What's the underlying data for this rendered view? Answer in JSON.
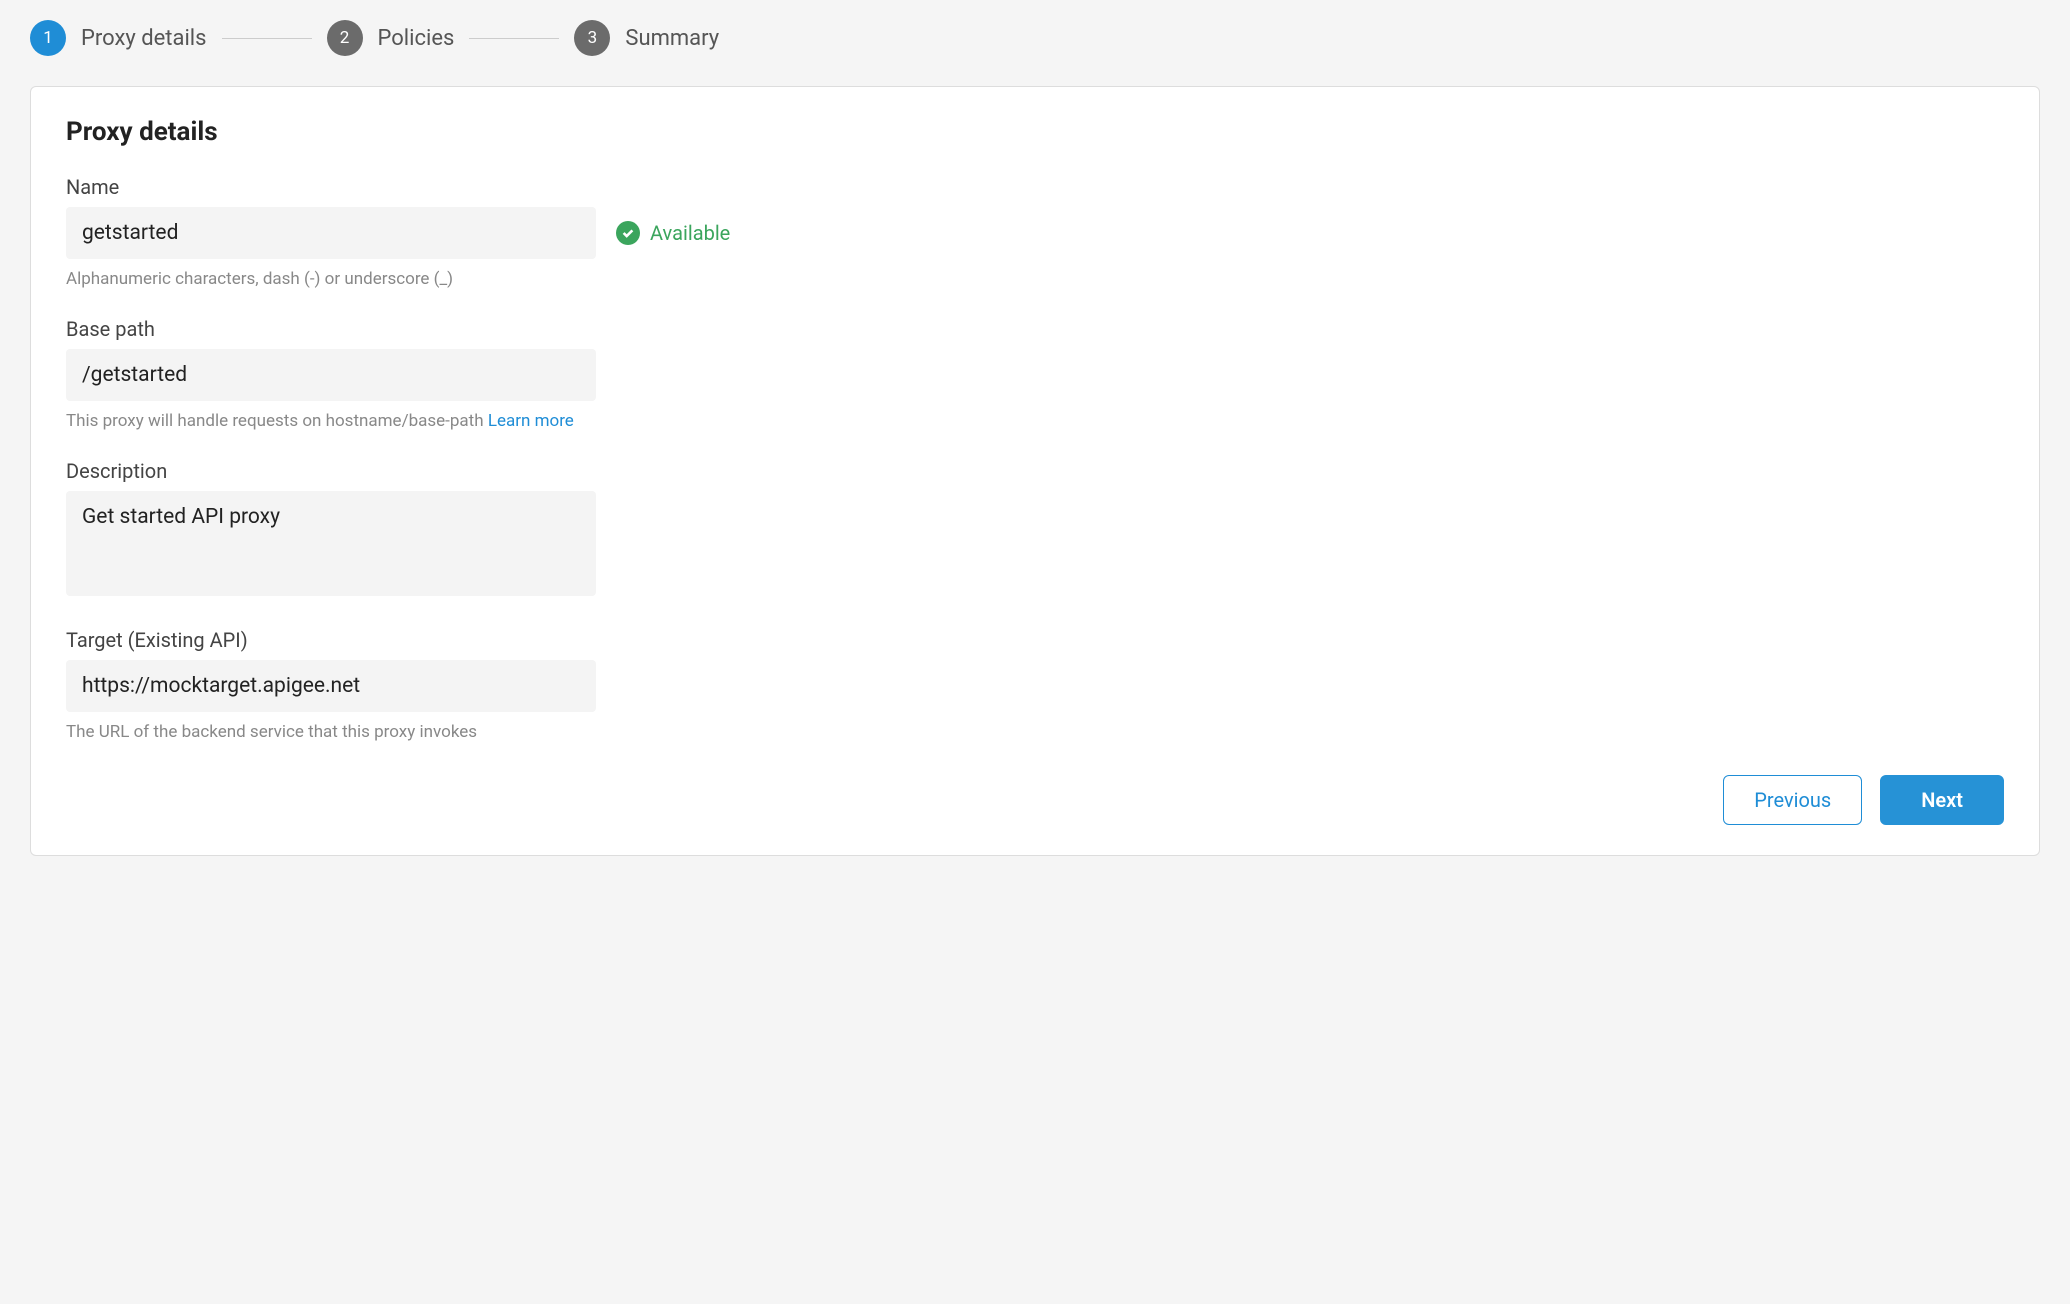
{
  "stepper": {
    "steps": [
      {
        "num": "1",
        "label": "Proxy details"
      },
      {
        "num": "2",
        "label": "Policies"
      },
      {
        "num": "3",
        "label": "Summary"
      }
    ]
  },
  "panel": {
    "title": "Proxy details"
  },
  "form": {
    "name": {
      "label": "Name",
      "value": "getstarted",
      "helper": "Alphanumeric characters, dash (-) or underscore (_)",
      "availability": "Available"
    },
    "basepath": {
      "label": "Base path",
      "value": "/getstarted",
      "helper": "This proxy will handle requests on hostname/base-path ",
      "learn_more": "Learn more"
    },
    "description": {
      "label": "Description",
      "value": "Get started API proxy"
    },
    "target": {
      "label": "Target (Existing API)",
      "value": "https://mocktarget.apigee.net",
      "helper": "The URL of the backend service that this proxy invokes"
    }
  },
  "buttons": {
    "previous": "Previous",
    "next": "Next"
  }
}
